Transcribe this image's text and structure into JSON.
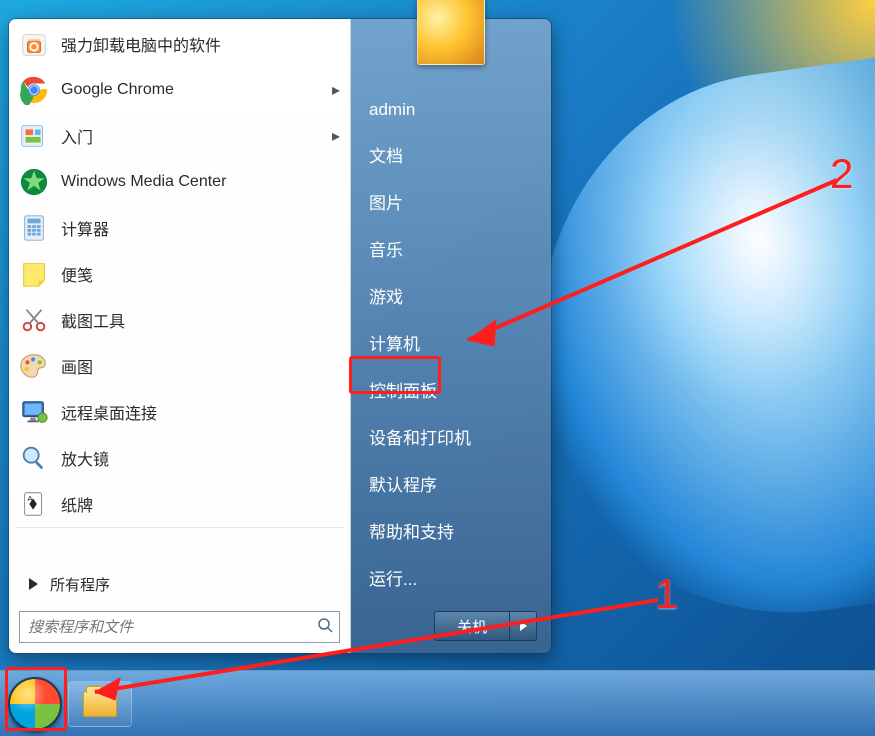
{
  "search": {
    "placeholder": "搜索程序和文件"
  },
  "left_apps": [
    {
      "label": "强力卸载电脑中的软件",
      "icon": "uninstall-icon",
      "submenu": false
    },
    {
      "label": "Google Chrome",
      "icon": "chrome-icon",
      "submenu": true
    },
    {
      "label": "入门",
      "icon": "getting-started-icon",
      "submenu": true
    },
    {
      "label": "Windows Media Center",
      "icon": "media-center-icon",
      "submenu": false
    },
    {
      "label": "计算器",
      "icon": "calculator-icon",
      "submenu": false
    },
    {
      "label": "便笺",
      "icon": "sticky-notes-icon",
      "submenu": false
    },
    {
      "label": "截图工具",
      "icon": "scissors-icon",
      "submenu": false
    },
    {
      "label": "画图",
      "icon": "paint-icon",
      "submenu": false
    },
    {
      "label": "远程桌面连接",
      "icon": "remote-desktop-icon",
      "submenu": false
    },
    {
      "label": "放大镜",
      "icon": "magnifier-icon",
      "submenu": false
    },
    {
      "label": "纸牌",
      "icon": "solitaire-icon",
      "submenu": false
    }
  ],
  "all_programs_label": "所有程序",
  "right_items": [
    "admin",
    "文档",
    "图片",
    "音乐",
    "游戏",
    "计算机",
    "控制面板",
    "设备和打印机",
    "默认程序",
    "帮助和支持",
    "运行..."
  ],
  "shutdown_label": "关机",
  "annotations": {
    "label_1": "1",
    "label_2": "2"
  }
}
